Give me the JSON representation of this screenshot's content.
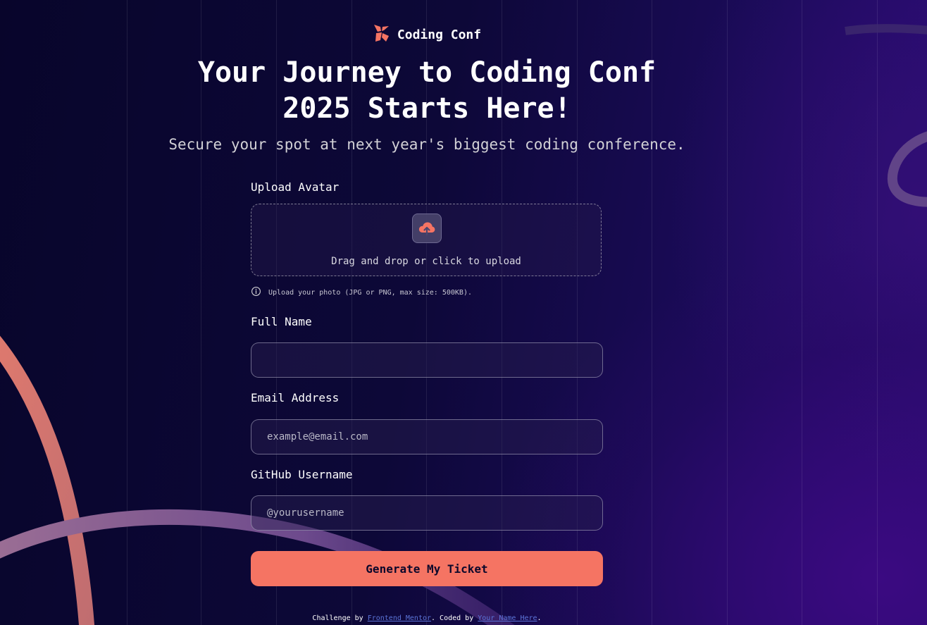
{
  "brand": {
    "name": "Coding Conf"
  },
  "hero": {
    "title": "Your Journey to Coding Conf 2025 Starts Here!",
    "subtitle": "Secure your spot at next year's biggest coding conference."
  },
  "form": {
    "avatar": {
      "label": "Upload Avatar",
      "dropzone_text": "Drag and drop or click to upload",
      "hint": "Upload your photo (JPG or PNG, max size: 500KB)."
    },
    "full_name": {
      "label": "Full Name",
      "value": "",
      "placeholder": ""
    },
    "email": {
      "label": "Email Address",
      "value": "",
      "placeholder": "example@email.com"
    },
    "github": {
      "label": "GitHub Username",
      "value": "",
      "placeholder": "@yourusername"
    },
    "submit_label": "Generate My Ticket"
  },
  "footer": {
    "prefix": "Challenge by ",
    "mentor_link": "Frontend Mentor",
    "middle": ". Coded by ",
    "author_link": "Your Name Here",
    "suffix": "."
  },
  "colors": {
    "accent": "#f57463",
    "background": "#0b0633",
    "link": "#5b74d8"
  },
  "icons": {
    "logo": "coding-conf-logo-icon",
    "upload": "cloud-upload-icon",
    "info": "info-icon"
  }
}
